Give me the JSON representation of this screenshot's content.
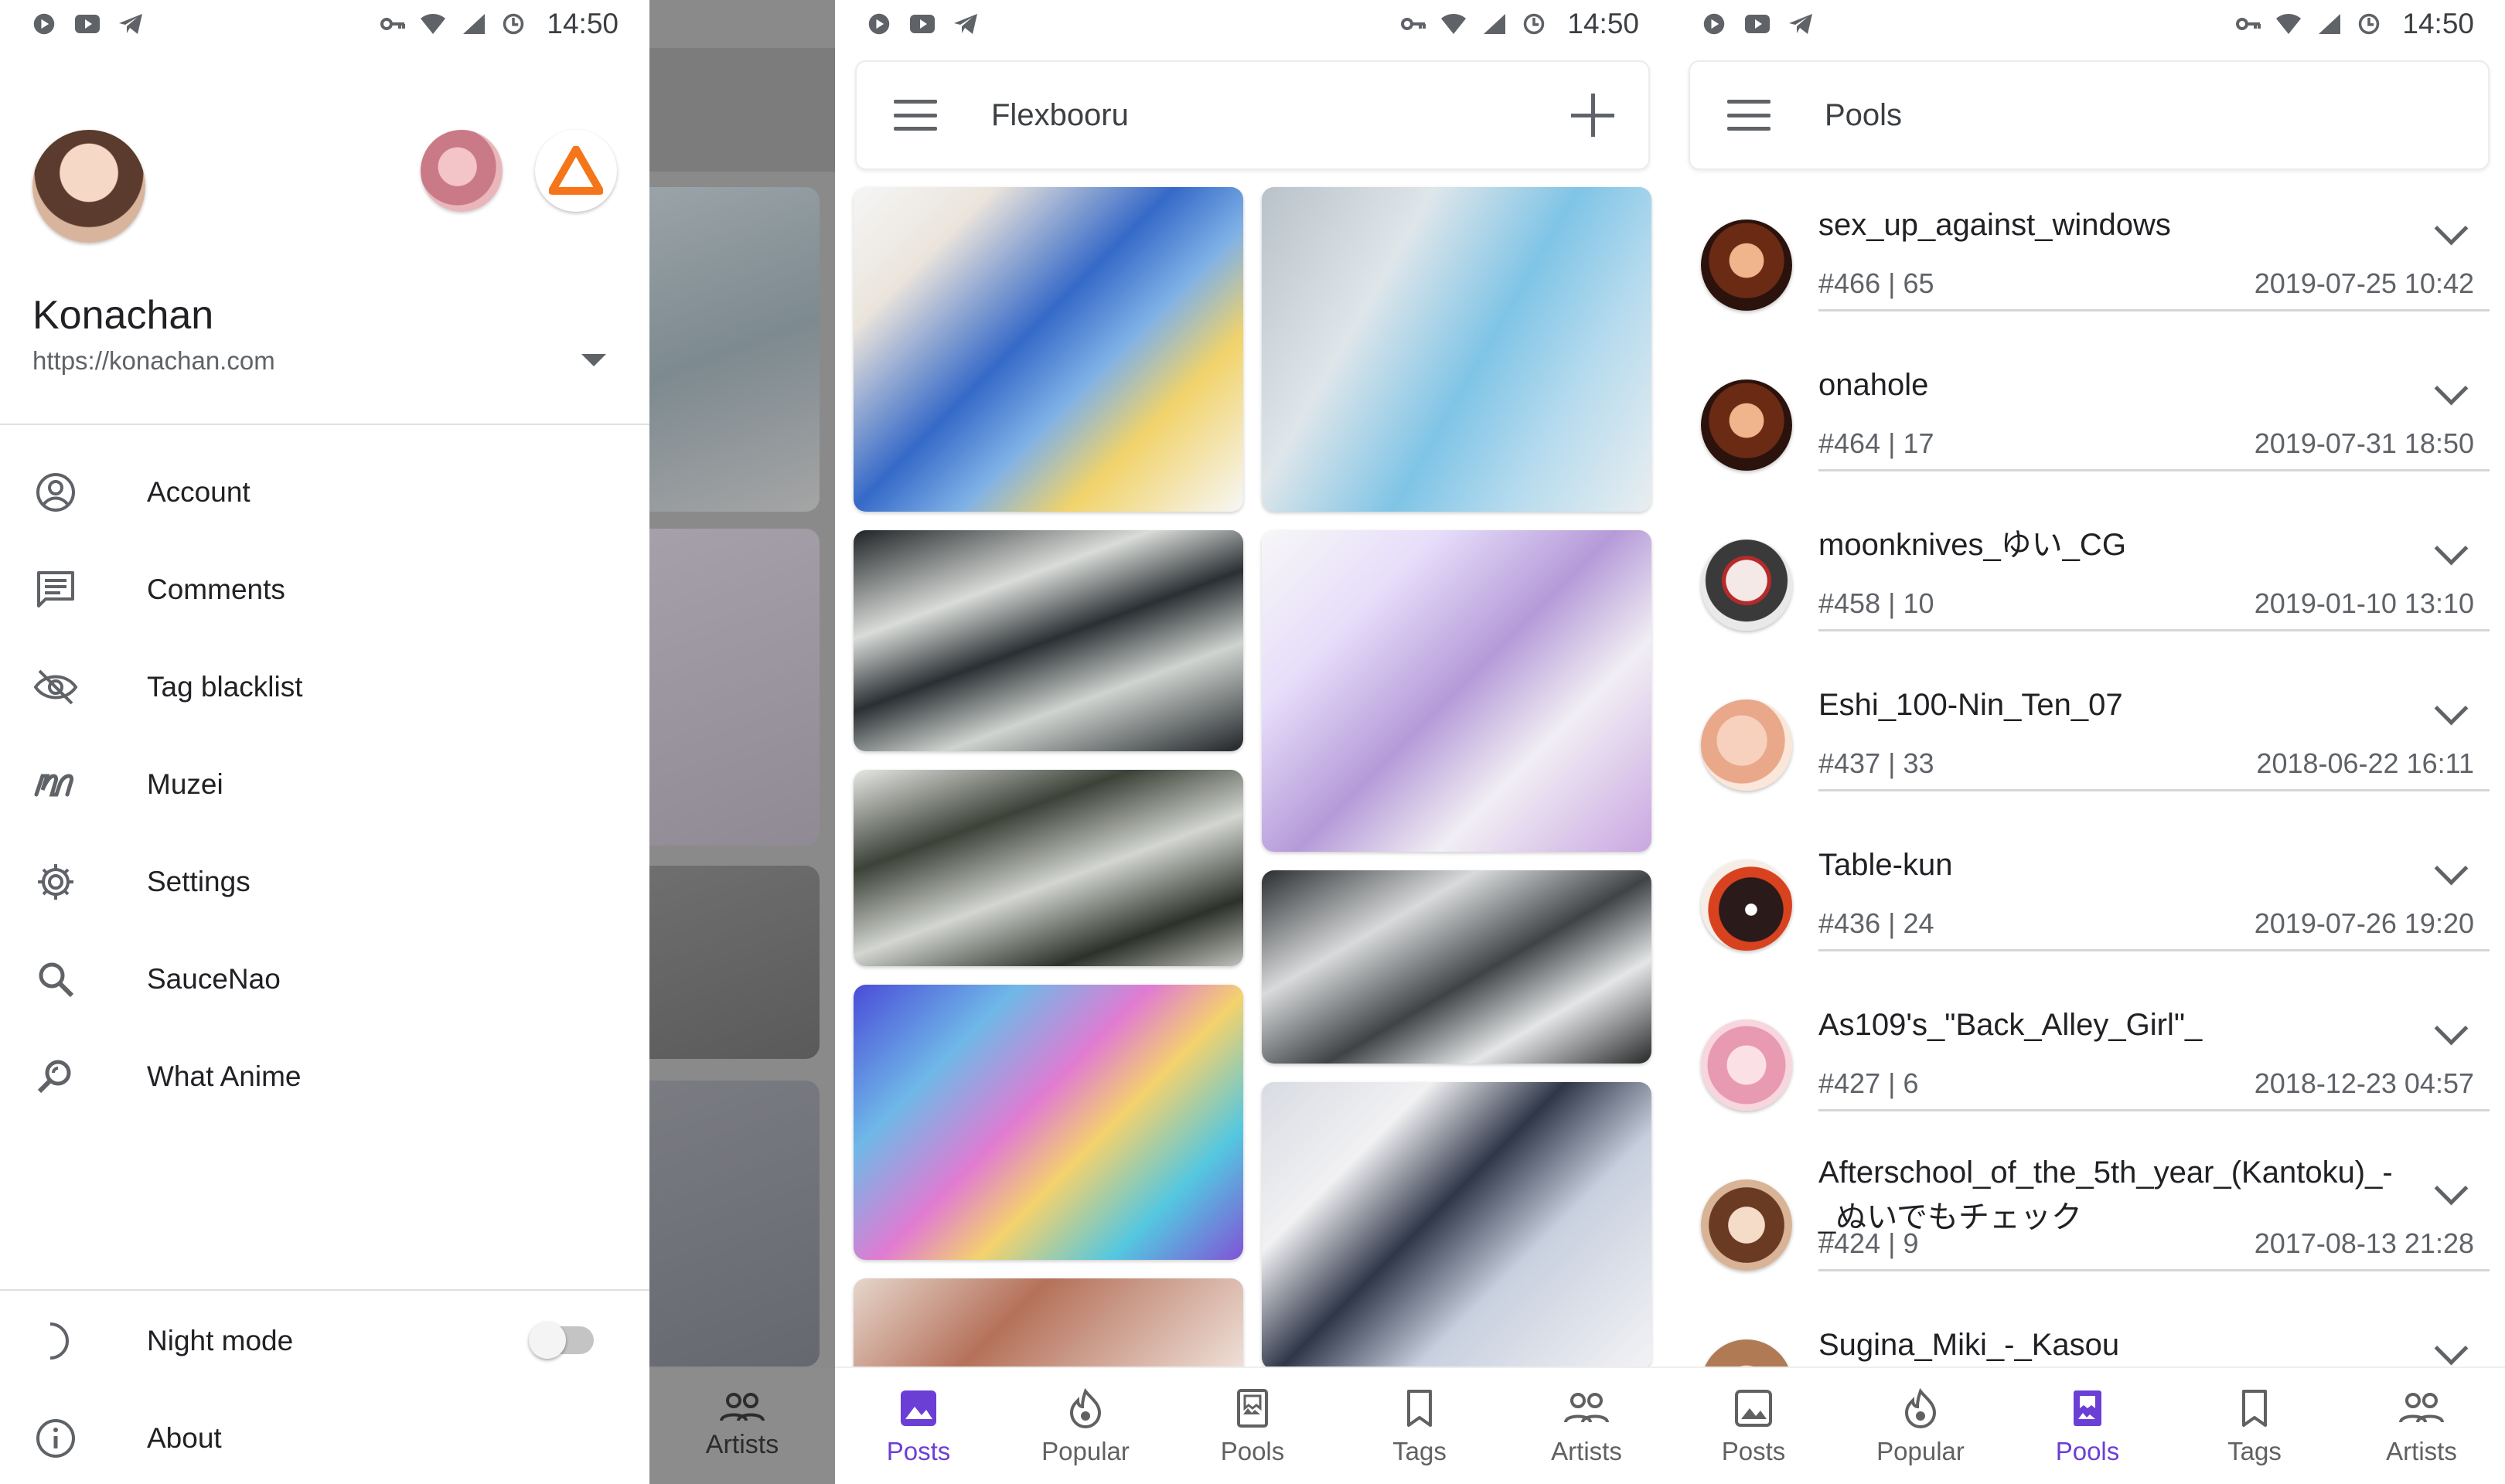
{
  "status": {
    "time": "14:50"
  },
  "drawer": {
    "site_name": "Konachan",
    "site_url": "https://konachan.com",
    "menu": [
      {
        "label": "Account",
        "icon": "account-circle-icon"
      },
      {
        "label": "Comments",
        "icon": "comment-icon"
      },
      {
        "label": "Tag blacklist",
        "icon": "eye-off-icon"
      },
      {
        "label": "Muzei",
        "icon": "muzei-icon"
      },
      {
        "label": "Settings",
        "icon": "gear-icon"
      },
      {
        "label": "SauceNao",
        "icon": "search-icon"
      },
      {
        "label": "What Anime",
        "icon": "image-search-icon"
      }
    ],
    "night_mode": {
      "label": "Night mode",
      "enabled": false
    },
    "about": {
      "label": "About"
    },
    "behind_nav_label": "Artists"
  },
  "posts_screen": {
    "title": "Flexbooru",
    "nav": [
      {
        "label": "Posts",
        "icon": "image-icon",
        "active": true
      },
      {
        "label": "Popular",
        "icon": "fire-icon",
        "active": false
      },
      {
        "label": "Pools",
        "icon": "book-icon",
        "active": false
      },
      {
        "label": "Tags",
        "icon": "bookmark-icon",
        "active": false
      },
      {
        "label": "Artists",
        "icon": "people-icon",
        "active": false
      }
    ]
  },
  "pools_screen": {
    "title": "Pools",
    "pools": [
      {
        "name": "sex_up_against_windows",
        "meta": "#466 | 65",
        "date": "2019-07-25 10:42"
      },
      {
        "name": "onahole",
        "meta": "#464 | 17",
        "date": "2019-07-31 18:50"
      },
      {
        "name": "moonknives_ゆい_CG",
        "meta": "#458 | 10",
        "date": "2019-01-10 13:10"
      },
      {
        "name": "Eshi_100-Nin_Ten_07",
        "meta": "#437 | 33",
        "date": "2018-06-22 16:11"
      },
      {
        "name": "Table-kun",
        "meta": "#436 | 24",
        "date": "2019-07-26 19:20"
      },
      {
        "name": "As109's_\"Back_Alley_Girl\"_",
        "meta": "#427 | 6",
        "date": "2018-12-23 04:57"
      },
      {
        "name": "Afterschool_of_the_5th_year_(Kantoku)_-_ぬいでもチェック",
        "meta": "#424 | 9",
        "date": "2017-08-13 21:28"
      },
      {
        "name": "Sugina_Miki_-_Kasou",
        "meta": "",
        "date": ""
      }
    ],
    "nav": [
      {
        "label": "Posts",
        "icon": "image-icon",
        "active": false
      },
      {
        "label": "Popular",
        "icon": "fire-icon",
        "active": false
      },
      {
        "label": "Pools",
        "icon": "book-icon",
        "active": true
      },
      {
        "label": "Tags",
        "icon": "bookmark-icon",
        "active": false
      },
      {
        "label": "Artists",
        "icon": "people-icon",
        "active": false
      }
    ]
  }
}
